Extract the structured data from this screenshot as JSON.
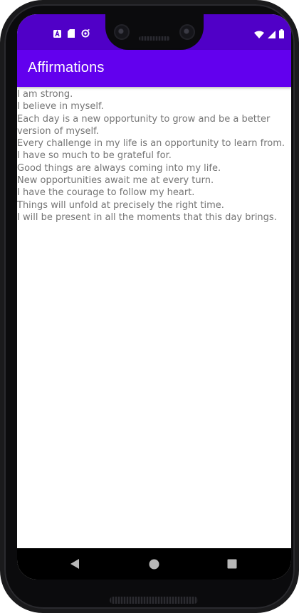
{
  "app": {
    "title": "Affirmations"
  },
  "status_bar": {
    "icons": [
      "app-a-icon",
      "sd-card-icon",
      "sync-icon",
      "wifi-icon",
      "signal-icon",
      "battery-icon"
    ]
  },
  "affirmations": [
    "I am strong.",
    "I believe in myself.",
    "Each day is a new opportunity to grow and be a better version of myself.",
    "Every challenge in my life is an opportunity to learn from.",
    "I have so much to be grateful for.",
    "Good things are always coming into my life.",
    "New opportunities await me at every turn.",
    "I have the courage to follow my heart.",
    "Things will unfold at precisely the right time.",
    "I will be present in all the moments that this day brings."
  ],
  "nav_bar": {
    "buttons": [
      "back-icon",
      "home-icon",
      "recents-icon"
    ]
  },
  "colors": {
    "status_bar": "#5000c7",
    "app_bar": "#6200ee",
    "title_text": "#ffffff",
    "item_text": "#757575",
    "nav_bar": "#000000"
  }
}
